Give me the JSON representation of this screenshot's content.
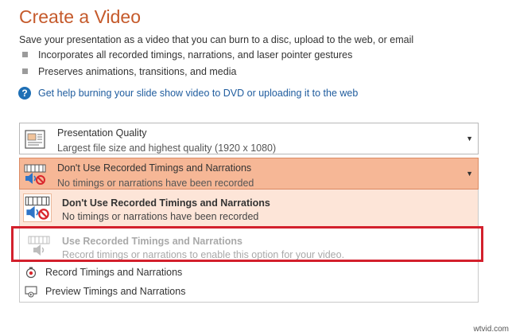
{
  "page": {
    "title": "Create a Video",
    "description": "Save your presentation as a video that you can burn to a disc, upload to the web, or email",
    "bullets": [
      "Incorporates all recorded timings, narrations, and laser pointer gestures",
      "Preserves animations, transitions, and media"
    ],
    "help_link": "Get help burning your slide show video to DVD or uploading it to the web"
  },
  "quality_dropdown": {
    "title": "Presentation Quality",
    "subtitle": "Largest file size and highest quality (1920 x 1080)",
    "icon": "presentation-quality-icon"
  },
  "timings_dropdown": {
    "title": "Don't Use Recorded Timings and Narrations",
    "subtitle": "No timings or narrations have been recorded",
    "icon": "no-narration-icon",
    "expanded": true
  },
  "options": [
    {
      "title": "Don't Use Recorded Timings and Narrations",
      "subtitle": "No timings or narrations have been recorded",
      "selected": true,
      "enabled": true
    },
    {
      "title": "Use Recorded Timings and Narrations",
      "subtitle": "Record timings or narrations to enable this option for your video.",
      "selected": false,
      "enabled": false
    }
  ],
  "menu_commands": [
    {
      "label": "Record Timings and Narrations",
      "icon": "record-icon"
    },
    {
      "label": "Preview Timings and Narrations",
      "icon": "preview-icon"
    }
  ],
  "watermark": "wtvid.com",
  "colors": {
    "title": "#c55a2b",
    "link": "#1f5c9e",
    "selected_dropdown": "#f6b796",
    "selected_option": "#fde5d8",
    "highlight": "#d3202c"
  }
}
